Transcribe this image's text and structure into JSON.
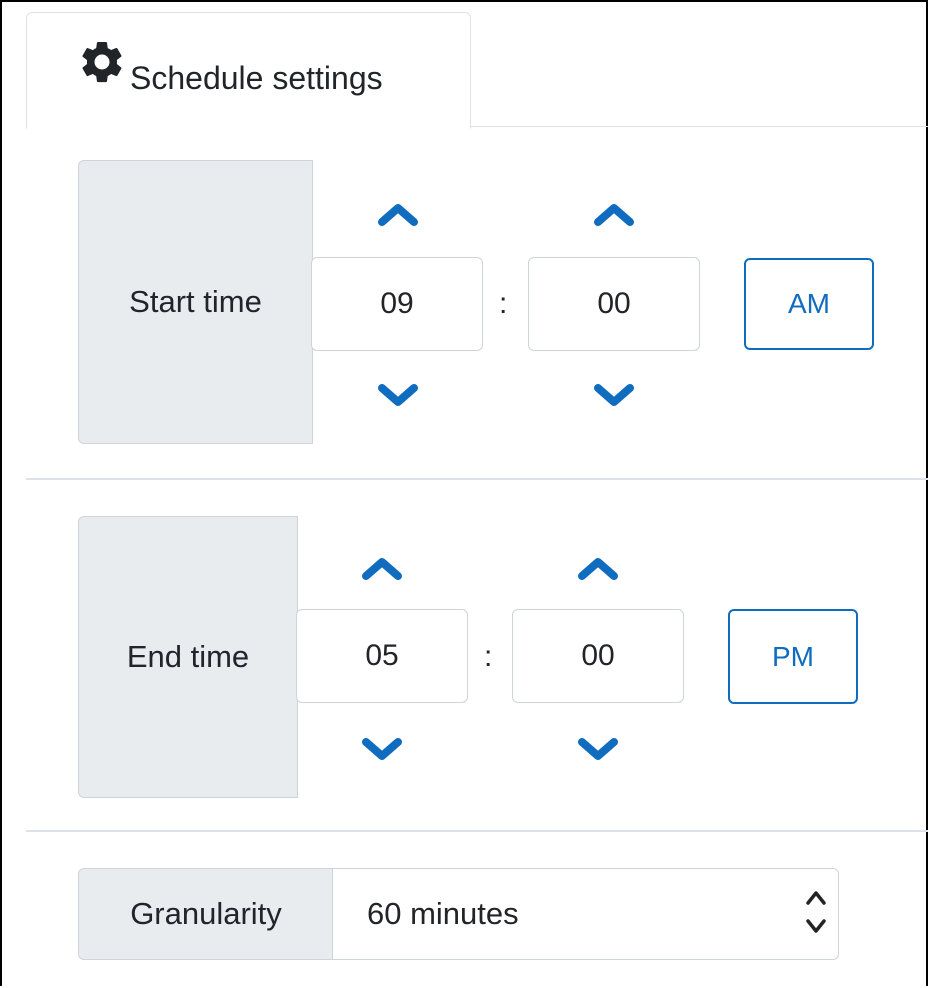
{
  "tab": {
    "label": "Schedule settings",
    "icon": "gear-icon"
  },
  "start_time": {
    "label": "Start time",
    "hours": "09",
    "minutes": "00",
    "separator": ":",
    "period": "AM"
  },
  "end_time": {
    "label": "End time",
    "hours": "05",
    "minutes": "00",
    "separator": ":",
    "period": "PM"
  },
  "granularity": {
    "label": "Granularity",
    "value": "60 minutes"
  },
  "colors": {
    "accent": "#0f6cbf",
    "chevron": "#0f6cbf",
    "addon_bg": "#e9ecef",
    "border": "#ced4da"
  }
}
